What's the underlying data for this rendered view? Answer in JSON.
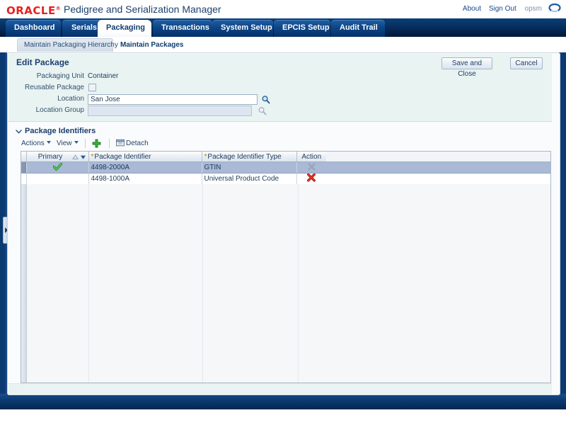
{
  "branding": {
    "logo_text": "ORACLE",
    "app_title": "Pedigree and Serialization Manager",
    "links": [
      {
        "label": "About",
        "name": "about-link"
      },
      {
        "label": "Sign Out",
        "name": "sign-out-link"
      }
    ],
    "user_id": "opsm"
  },
  "main_tabs": [
    {
      "label": "Dashboard",
      "selected": false
    },
    {
      "label": "Serials",
      "selected": false
    },
    {
      "label": "Packaging",
      "selected": true
    },
    {
      "label": "Transactions",
      "selected": false
    },
    {
      "label": "System Setup",
      "selected": false
    },
    {
      "label": "EPCIS Setup",
      "selected": false
    },
    {
      "label": "Audit Trail",
      "selected": false
    }
  ],
  "sub_tabs": [
    {
      "label": "Maintain Packaging Hierarchy",
      "selected": false
    },
    {
      "label": "Maintain Packages",
      "selected": true
    }
  ],
  "edit_package": {
    "title": "Edit Package",
    "packaging_unit_label": "Packaging Unit",
    "packaging_unit_value": "Container",
    "reusable_label": "Reusable Package",
    "reusable_checked": false,
    "location_label": "Location",
    "location_value": "San Jose",
    "location_placeholder": "",
    "location_group_label": "Location Group",
    "location_group_value": "",
    "location_group_placeholder": "",
    "location_group_disabled": true
  },
  "actions": {
    "save_and_close": "Save and Close",
    "cancel": "Cancel"
  },
  "package_identifiers": {
    "section_title": "Package Identifiers",
    "toolbar": {
      "actions_label": "Actions",
      "view_label": "View",
      "add_icon": "plus-icon",
      "detach_label": "Detach",
      "detach_icon": "detach-icon"
    },
    "columns": [
      {
        "label": "Primary",
        "required": false,
        "sorted": true
      },
      {
        "label": "Package Identifier",
        "required": true,
        "sorted": false
      },
      {
        "label": "Package Identifier Type",
        "required": true,
        "sorted": false
      },
      {
        "label": "Action",
        "required": false,
        "sorted": false
      }
    ],
    "rows": [
      {
        "primary": true,
        "identifier": "4498-2000A",
        "identifier_type": "GTIN",
        "action_icon": "delete-icon-disabled",
        "selected": true
      },
      {
        "primary": false,
        "identifier": "4498-1000A",
        "identifier_type": "Universal Product Code",
        "action_icon": "delete-icon",
        "selected": false
      }
    ]
  },
  "colors": {
    "oracle_red": "#e8201f",
    "header_blue": "#0b3a72",
    "tab_blue": "#0d4382",
    "selected_row": "#a9b9d6",
    "form_bg": "#e8f3f2",
    "delete_red": "#cc2222",
    "check_green": "#2faa2f",
    "required_star": "#b07b00"
  }
}
